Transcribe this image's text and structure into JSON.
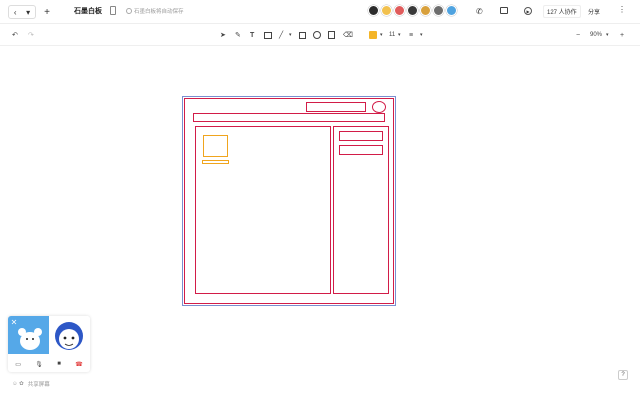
{
  "header": {
    "title": "石墨白板",
    "saved_text": "石墨白板将自动保存",
    "collab_label": "127 人协作",
    "share_label": "分享",
    "more_label": "⋮",
    "avatars": [
      {
        "color": "#2b2b2b"
      },
      {
        "color": "#f2c14e"
      },
      {
        "color": "#e05b5b"
      },
      {
        "color": "#3a3a3a"
      },
      {
        "color": "#d8a03c"
      },
      {
        "color": "#6d6d6d"
      },
      {
        "color": "#4fa3e0"
      }
    ]
  },
  "toolbar": {
    "undo": "↶",
    "redo": "↷",
    "tools": [
      "select-tool",
      "pen-tool",
      "text-tool",
      "image-tool",
      "line-tool",
      "rect-tool",
      "ellipse-tool",
      "note-tool",
      "eraser-tool"
    ],
    "text_tool_label": "T",
    "font_size": "11",
    "zoom_minus": "−",
    "zoom_value": "90%",
    "zoom_plus": "+",
    "accent_color": "#f4b528"
  },
  "wireframe": {
    "frame_color": "#d21c48",
    "accent_color": "#f0a51e"
  },
  "video_panel": {
    "controls": [
      "screen-icon",
      "mic-icon",
      "camera-icon",
      "hangup-icon"
    ],
    "status_text": "共享屏幕"
  },
  "help_label": "?"
}
